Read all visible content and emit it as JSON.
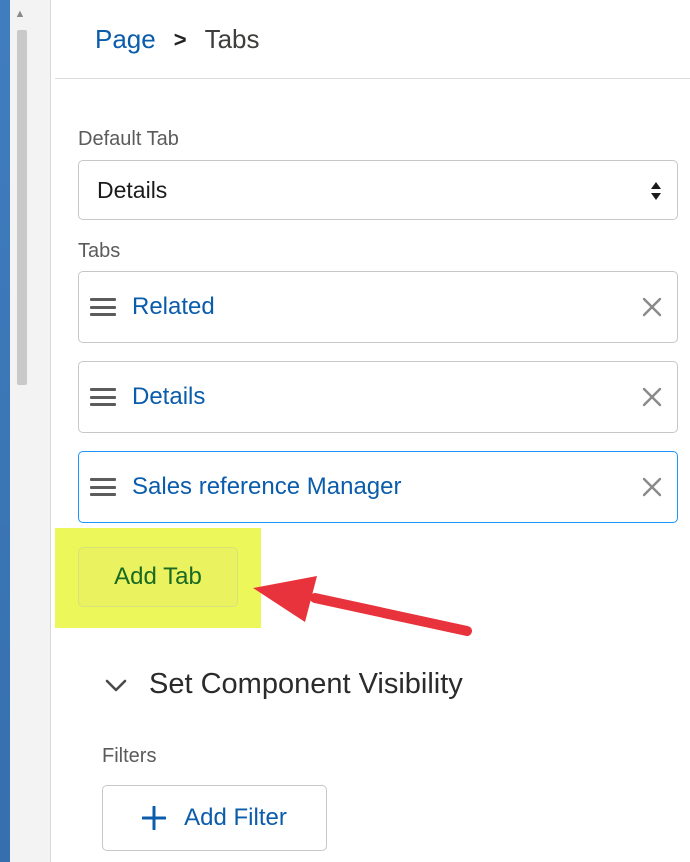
{
  "breadcrumb": {
    "parent": "Page",
    "separator": ">",
    "current": "Tabs"
  },
  "default_tab": {
    "label": "Default Tab",
    "value": "Details"
  },
  "tabs": {
    "label": "Tabs",
    "items": [
      {
        "label": "Related"
      },
      {
        "label": "Details"
      },
      {
        "label": "Sales reference Manager"
      }
    ],
    "add_button": "Add Tab"
  },
  "visibility": {
    "title": "Set Component Visibility",
    "filters_label": "Filters",
    "add_filter_button": "Add Filter"
  },
  "colors": {
    "link": "#0b5cab",
    "highlight": "#ecf75a",
    "annotation_arrow": "#e8323c",
    "active_border": "#1b96ff"
  },
  "icons": [
    "scroll-up-icon",
    "select-arrows-icon",
    "drag-handle-icon",
    "close-icon",
    "chevron-down-icon",
    "plus-icon",
    "annotation-arrow"
  ]
}
